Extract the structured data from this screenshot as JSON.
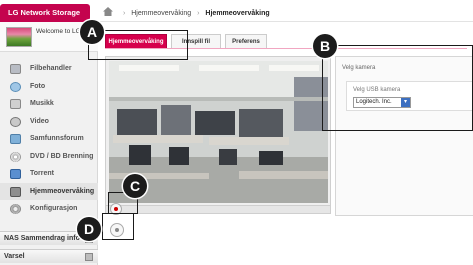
{
  "app": {
    "title": "LG Network Storage",
    "welcome": "Welcome to LG Network Storage"
  },
  "breadcrumb": {
    "parent": "Hjemmeovervåking",
    "current": "Hjemmeovervåking",
    "separator": "›"
  },
  "sidebar": {
    "items": [
      {
        "label": "Filbehandler",
        "icon": "folder-icon"
      },
      {
        "label": "Foto",
        "icon": "photo-icon"
      },
      {
        "label": "Musikk",
        "icon": "music-icon"
      },
      {
        "label": "Video",
        "icon": "video-icon"
      },
      {
        "label": "Samfunnsforum",
        "icon": "forum-icon"
      },
      {
        "label": "DVD / BD Brenning",
        "icon": "disc-icon"
      },
      {
        "label": "Torrent",
        "icon": "torrent-icon"
      },
      {
        "label": "Hjemmeovervåking",
        "icon": "camera-icon",
        "active": true
      },
      {
        "label": "Konfigurasjon",
        "icon": "gear-icon"
      }
    ],
    "sections": [
      "NAS Sammendrag info",
      "Varsel"
    ]
  },
  "tabs": [
    {
      "label": "Hjemmeovervåking",
      "active": true
    },
    {
      "label": "Innspill fil"
    },
    {
      "label": "Preferens"
    }
  ],
  "settings": {
    "title": "Velg kamera",
    "usb_label": "Velg USB kamera",
    "camera_value": "Logitech. Inc."
  },
  "callouts": [
    "A",
    "B",
    "C",
    "D"
  ],
  "colors": {
    "brand": "#c4044e",
    "accent_tab": "#d6004c",
    "sidebar_bg": "#f1f1f1"
  }
}
